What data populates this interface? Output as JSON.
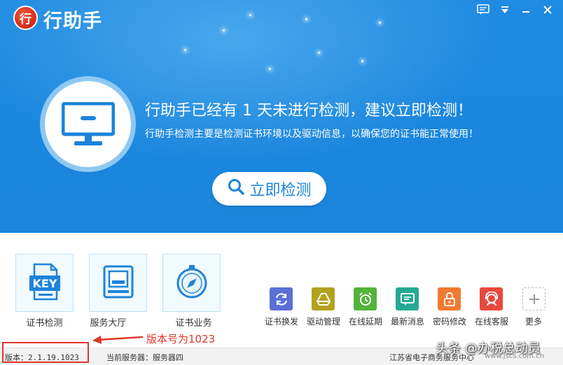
{
  "app": {
    "logo_char": "行",
    "title": "行助手"
  },
  "window_controls": {
    "feedback": "feedback-icon",
    "menu": "menu-icon",
    "minimize": "minimize-icon",
    "close": "close-icon"
  },
  "hero": {
    "headline": "行助手已经有 1 天未进行检测，建议立即检测！",
    "subline": "行助手检测主要是检测证书环境以及驱动信息，以确保您的证书能正常使用！",
    "detect_button": "立即检测",
    "accent_color": "#1f8be1"
  },
  "tiles": [
    {
      "label": "证书检测",
      "icon": "key-file-icon"
    },
    {
      "label": "服务大厅",
      "icon": "service-hall-icon"
    },
    {
      "label": "证书业务",
      "icon": "compass-icon"
    }
  ],
  "tools": [
    {
      "label": "证书换发",
      "icon": "renew-icon",
      "color": "#5b6fd6"
    },
    {
      "label": "驱动管理",
      "icon": "drive-icon",
      "color": "#b3a21f"
    },
    {
      "label": "在线延期",
      "icon": "alarm-icon",
      "color": "#53b33b"
    },
    {
      "label": "最新消息",
      "icon": "message-icon",
      "color": "#26a993"
    },
    {
      "label": "密码修改",
      "icon": "lock-icon",
      "color": "#f07a31"
    },
    {
      "label": "在线客服",
      "icon": "support-icon",
      "color": "#e8493d"
    },
    {
      "label": "更多",
      "icon": "plus-icon",
      "color": "#bbbbbb"
    }
  ],
  "annotation": {
    "text": "版本号为1023",
    "color": "#e0352b"
  },
  "status": {
    "version": "版本：2.1.19.1023",
    "server": "当前服务器：服务器四",
    "org": "江苏省电子商务服务中心"
  },
  "watermark": {
    "text": "头条 @办税总动员",
    "url": "www.jscs.com.cn"
  }
}
